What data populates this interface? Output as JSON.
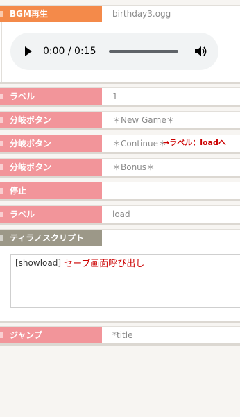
{
  "colors": {
    "bgm_tag": "#f48a4a",
    "pink_tag": "#f2959a",
    "script_tag": "#9c9888",
    "annotation": "#cc0000"
  },
  "rows": {
    "bgm": {
      "tag": "BGM再生",
      "value": "birthday3.ogg"
    },
    "audio": {
      "time": "0:00 / 0:15"
    },
    "label1": {
      "tag": "ラベル",
      "value": "1"
    },
    "branch1": {
      "tag": "分岐ボタン",
      "value": "＊New Game＊"
    },
    "branch2": {
      "tag": "分岐ボタン",
      "value": "＊Continue＊",
      "annotation": "→ラベル：loadへ"
    },
    "branch3": {
      "tag": "分岐ボタン",
      "value": "＊Bonus＊"
    },
    "stop": {
      "tag": "停止",
      "value": ""
    },
    "label2": {
      "tag": "ラベル",
      "value": "load"
    },
    "script": {
      "tag": "ティラノスクリプト",
      "code": "[showload]",
      "annotation": "セーブ画面呼び出し"
    },
    "jump": {
      "tag": "ジャンプ",
      "value": "*title"
    }
  }
}
